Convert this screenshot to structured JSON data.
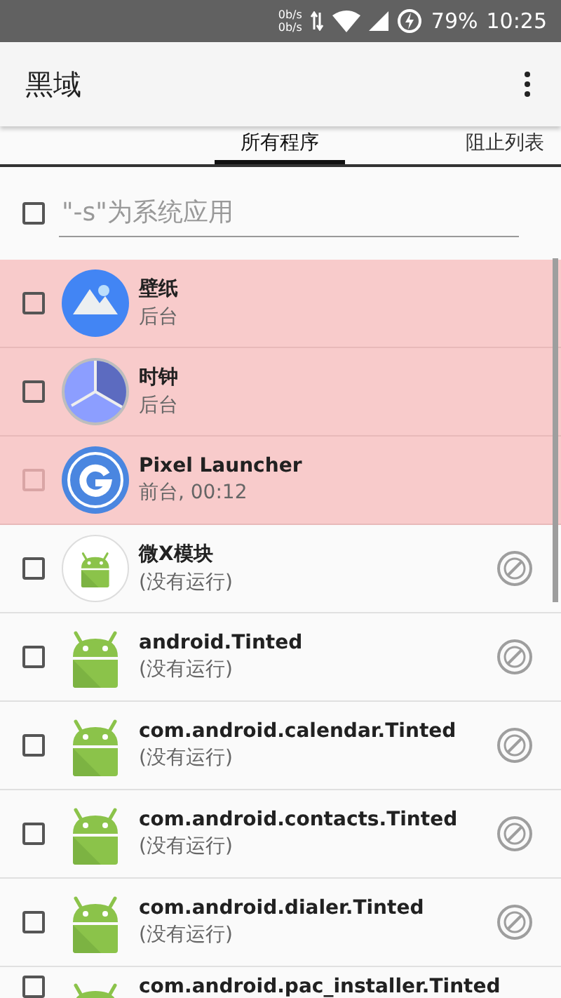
{
  "status_bar": {
    "net_speeds": [
      "0b/s",
      "0b/s"
    ],
    "battery": "79%",
    "time": "10:25"
  },
  "app_bar": {
    "title": "黑域"
  },
  "tabs": [
    {
      "label": "所有程序",
      "selected": true
    },
    {
      "label": "阻止列表",
      "selected": false
    }
  ],
  "filter": {
    "checked": false,
    "placeholder": "\"-s\"为系统应用"
  },
  "apps": [
    {
      "name": "壁纸",
      "status": "后台",
      "kind": "wallpaper",
      "running": true,
      "checked": false,
      "disabled": false,
      "blockable": false
    },
    {
      "name": "时钟",
      "status": "后台",
      "kind": "clock",
      "running": true,
      "checked": false,
      "disabled": false,
      "blockable": false
    },
    {
      "name": "Pixel Launcher",
      "status": "前台, 00:12",
      "kind": "google",
      "running": true,
      "checked": false,
      "disabled": true,
      "blockable": false
    },
    {
      "name": "微X模块",
      "status": "(没有运行)",
      "kind": "android-round",
      "running": false,
      "checked": false,
      "disabled": false,
      "blockable": true
    },
    {
      "name": "android.Tinted",
      "status": "(没有运行)",
      "kind": "android",
      "running": false,
      "checked": false,
      "disabled": false,
      "blockable": true
    },
    {
      "name": "com.android.calendar.Tinted",
      "status": "(没有运行)",
      "kind": "android",
      "running": false,
      "checked": false,
      "disabled": false,
      "blockable": true
    },
    {
      "name": "com.android.contacts.Tinted",
      "status": "(没有运行)",
      "kind": "android",
      "running": false,
      "checked": false,
      "disabled": false,
      "blockable": true
    },
    {
      "name": "com.android.dialer.Tinted",
      "status": "(没有运行)",
      "kind": "android",
      "running": false,
      "checked": false,
      "disabled": false,
      "blockable": true
    },
    {
      "name": "com.android.pac_installer.Tinted",
      "kind": "android",
      "running": false,
      "checked": false,
      "disabled": false,
      "blockable": false
    }
  ]
}
